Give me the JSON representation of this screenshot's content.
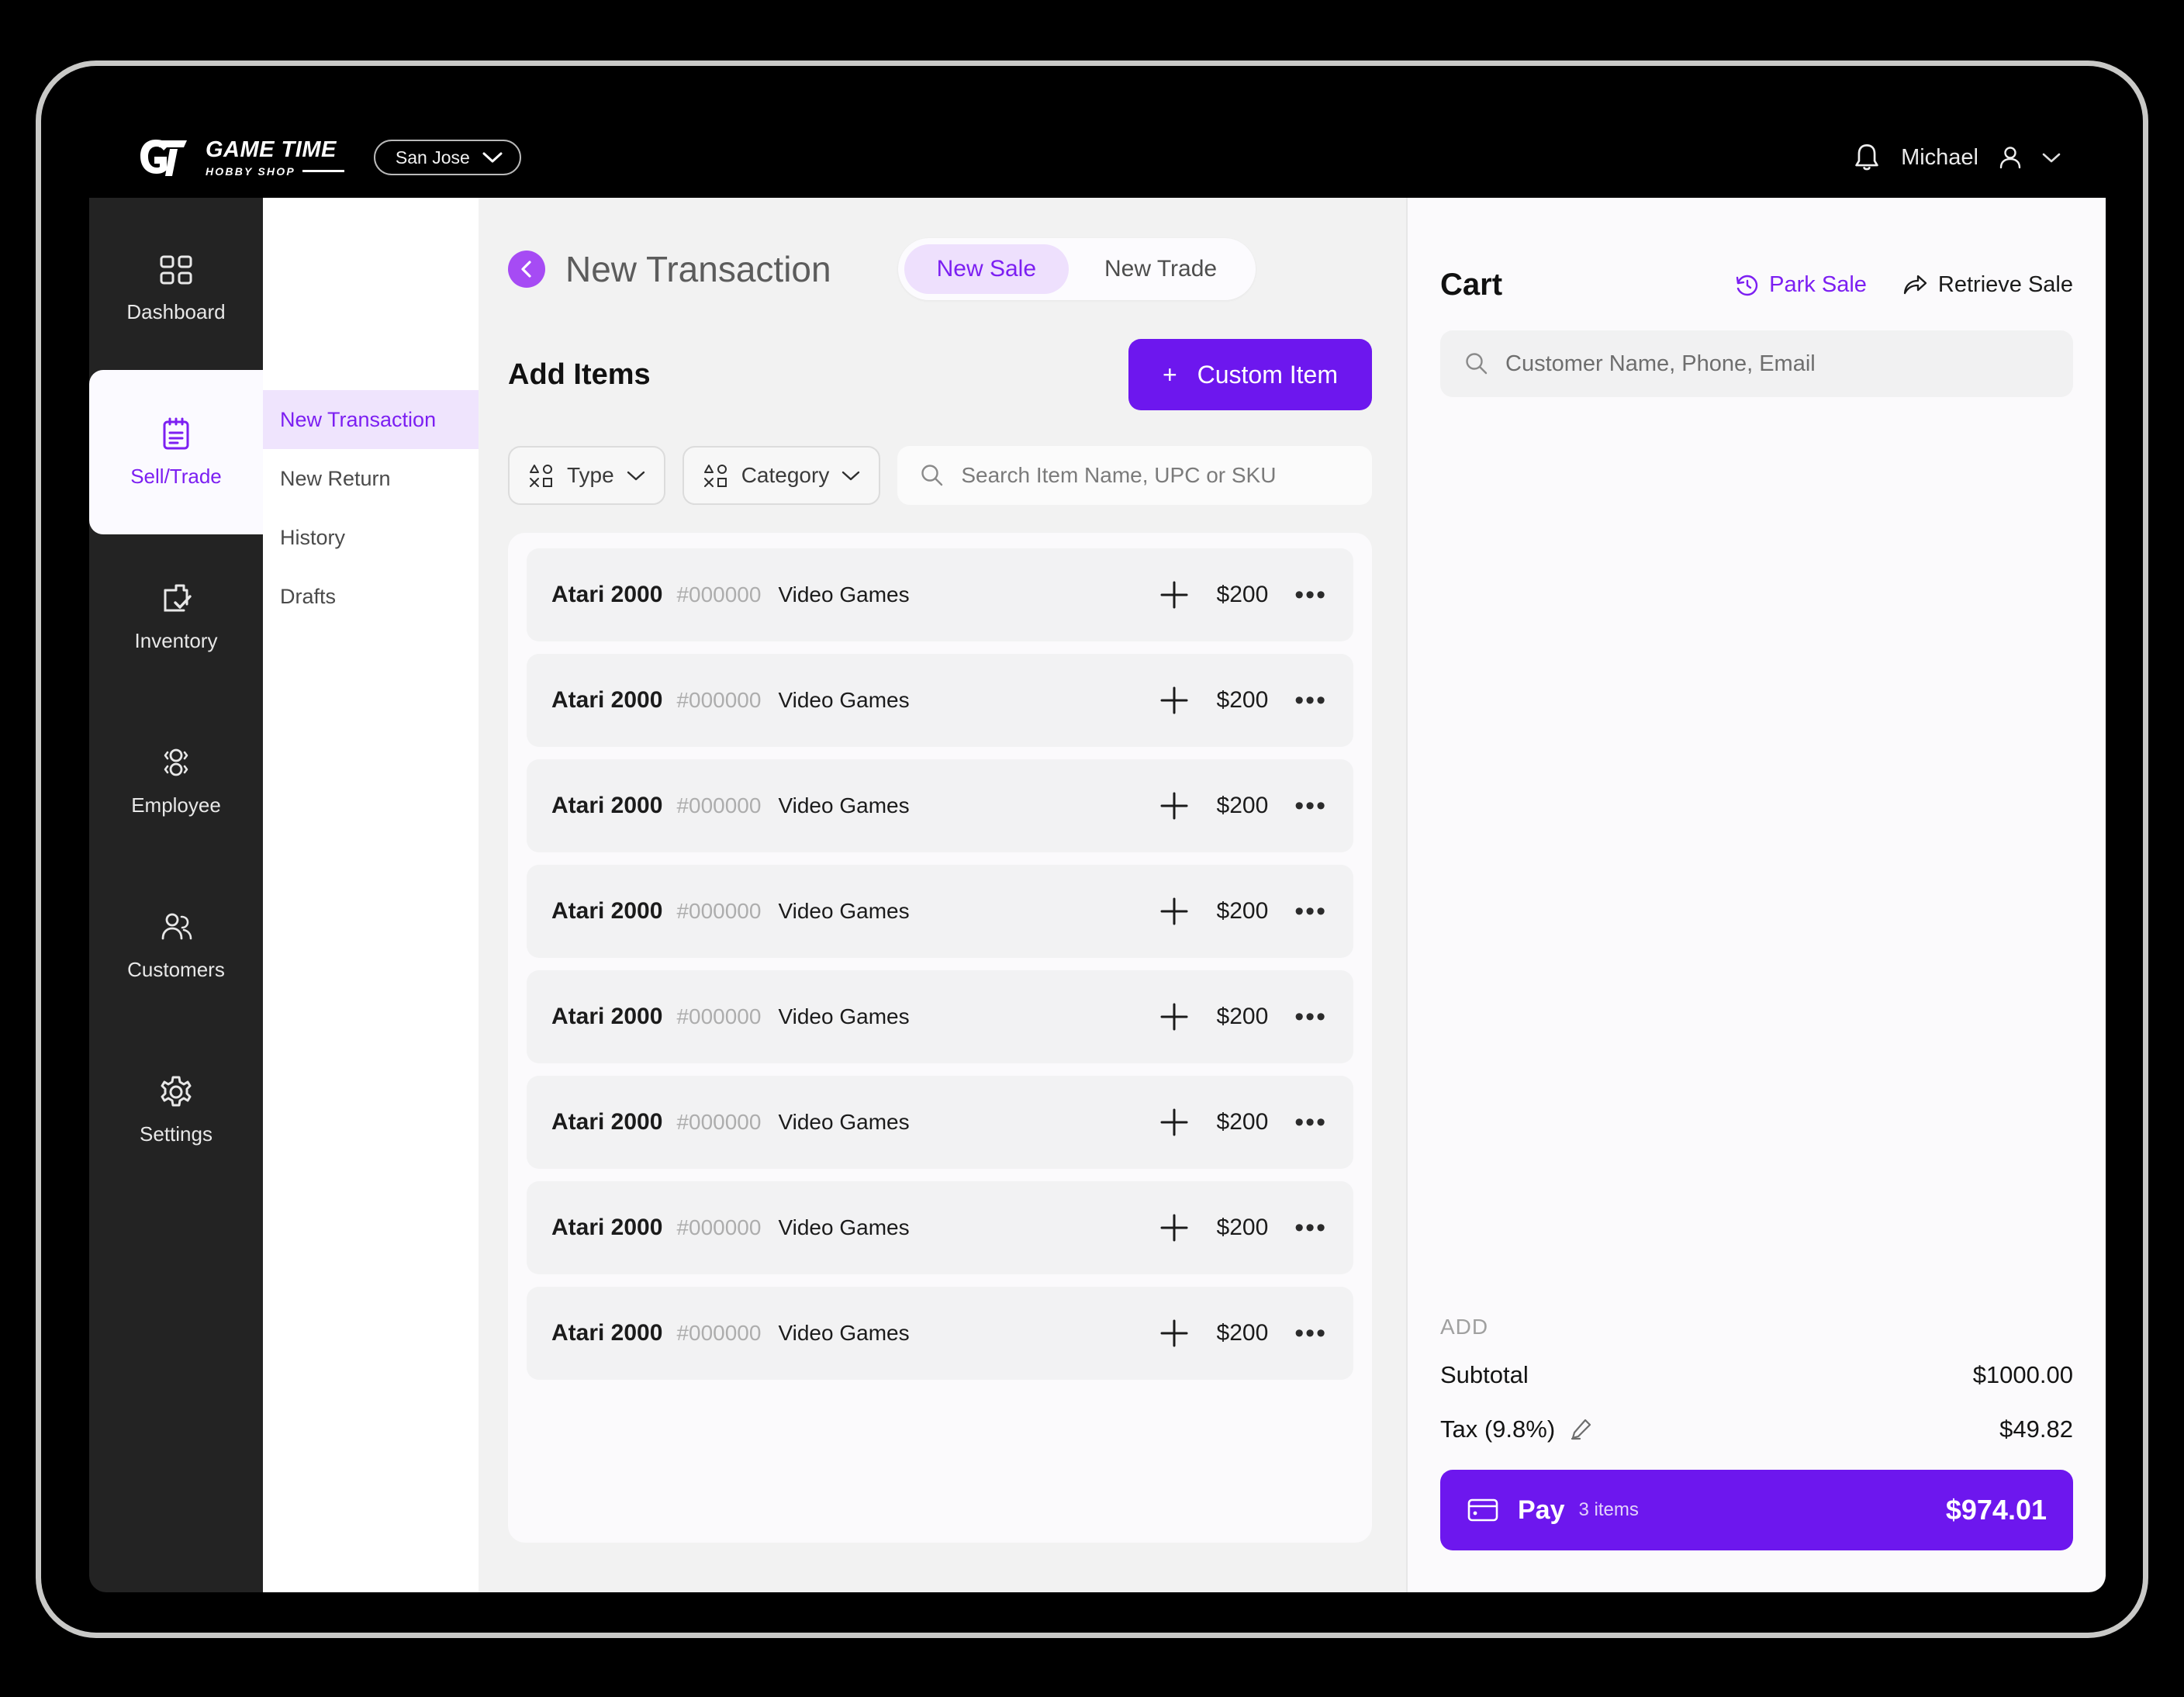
{
  "topbar": {
    "logo_title": "GAME TIME",
    "logo_subtitle": "HOBBY SHOP",
    "location": "San Jose",
    "user_name": "Michael",
    "bell_icon": "bell-icon",
    "user_icon": "user-icon",
    "chevron_icon": "chevron-down-icon"
  },
  "sidebar": {
    "items": [
      {
        "label": "Dashboard",
        "icon": "grid-icon",
        "active": false
      },
      {
        "label": "Sell/Trade",
        "icon": "clipboard-list-icon",
        "active": true
      },
      {
        "label": "Inventory",
        "icon": "clipboard-check-icon",
        "active": false
      },
      {
        "label": "Employee",
        "icon": "employee-icon",
        "active": false
      },
      {
        "label": "Customers",
        "icon": "customers-icon",
        "active": false
      },
      {
        "label": "Settings",
        "icon": "gear-icon",
        "active": false
      }
    ]
  },
  "subnav": {
    "items": [
      {
        "label": "New Transaction",
        "active": true
      },
      {
        "label": "New Return",
        "active": false
      },
      {
        "label": "History",
        "active": false
      },
      {
        "label": "Drafts",
        "active": false
      }
    ]
  },
  "main": {
    "back_icon": "chevron-left-icon",
    "page_title": "New Transaction",
    "tabs": [
      {
        "label": "New Sale",
        "active": true
      },
      {
        "label": "New Trade",
        "active": false
      }
    ],
    "section_title": "Add Items",
    "custom_item_button": "Custom Item",
    "custom_item_plus": "+",
    "filters": [
      {
        "label": "Type",
        "icon": "shapes-icon"
      },
      {
        "label": "Category",
        "icon": "shapes-icon"
      }
    ],
    "search_placeholder": "Search Item Name, UPC or SKU",
    "items": [
      {
        "name": "Atari 2000",
        "sku": "#000000",
        "category": "Video Games",
        "price": "$200"
      },
      {
        "name": "Atari 2000",
        "sku": "#000000",
        "category": "Video Games",
        "price": "$200"
      },
      {
        "name": "Atari 2000",
        "sku": "#000000",
        "category": "Video Games",
        "price": "$200"
      },
      {
        "name": "Atari 2000",
        "sku": "#000000",
        "category": "Video Games",
        "price": "$200"
      },
      {
        "name": "Atari 2000",
        "sku": "#000000",
        "category": "Video Games",
        "price": "$200"
      },
      {
        "name": "Atari 2000",
        "sku": "#000000",
        "category": "Video Games",
        "price": "$200"
      },
      {
        "name": "Atari 2000",
        "sku": "#000000",
        "category": "Video Games",
        "price": "$200"
      },
      {
        "name": "Atari 2000",
        "sku": "#000000",
        "category": "Video Games",
        "price": "$200"
      }
    ],
    "row_menu_glyph": "•••"
  },
  "cart": {
    "title": "Cart",
    "park_sale": "Park Sale",
    "retrieve_sale": "Retrieve Sale",
    "park_icon": "clock-rewind-icon",
    "retrieve_icon": "share-arrow-icon",
    "customer_placeholder": "Customer Name, Phone, Email",
    "add_label": "ADD",
    "subtotal_label": "Subtotal",
    "subtotal_value": "$1000.00",
    "tax_label": "Tax (9.8%)",
    "tax_edit_icon": "edit-pencil-icon",
    "tax_value": "$49.82",
    "pay_label": "Pay",
    "pay_items": "3 items",
    "pay_total": "$974.01",
    "pay_icon": "card-icon"
  },
  "colors": {
    "accent": "#6d17ee",
    "accent_light": "#a64bf4",
    "accent_soft": "#efe4fd",
    "rail_bg": "#232323",
    "panel_bg": "#f2f2f2"
  }
}
